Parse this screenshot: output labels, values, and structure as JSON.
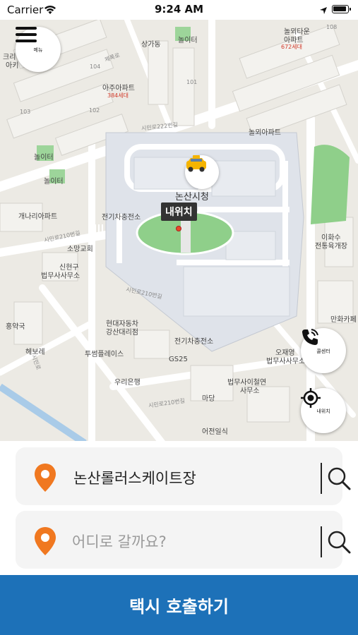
{
  "status_bar": {
    "carrier": "Carrier",
    "time": "9:24 AM"
  },
  "map": {
    "menu_label": "메뉴",
    "call_center_label": "콜센터",
    "my_location_label": "내위치",
    "my_location_tag": "내위치",
    "city_hall": "논산시청",
    "places": {
      "shopping": "상가동",
      "playground_top": "놀이터",
      "nolwe_town": "놀뫼타운",
      "nolwe_town2": "아파트",
      "nolwe_units": "672세대",
      "ajoo": "아주아파트",
      "ajoo_units": "384세대",
      "nolwe_apt": "놀뫼아파트",
      "kurdo": "크리",
      "kurdo2": "아키",
      "playground_left1": "놀이터",
      "playground_left2": "놀이터",
      "gaenari": "개나리아파트",
      "ev_charge1": "전기차충전소",
      "somang": "소망교회",
      "shinhyeon": "신현구",
      "shinhyeon2": "법무사사무소",
      "ihwasu": "이화수",
      "ihwasu2": "전통육개장",
      "hongyak": "홍약국",
      "hyundai": "현대자동차",
      "hyundai2": "강산대리점",
      "manhwa": "만화카페",
      "hebo": "헤보레",
      "tusum": "투썸플레이스",
      "ev_charge2": "전기차충전소",
      "oh_jae": "오재영",
      "oh_jae2": "법무사사무소",
      "gs25": "GS25",
      "woori": "우리은행",
      "bupmu": "법무사이철연",
      "bupmu2": "사무소",
      "madang": "마당",
      "eojeon": "어전일식"
    },
    "roads": {
      "r1": "시민로222번길",
      "r2": "시민로210번길",
      "r3": "시민로210번길",
      "r4": "시민로210번길",
      "r5": "시민로",
      "r6": "제록로"
    },
    "blocks": {
      "b104": "104",
      "b103": "103",
      "b102": "102",
      "b101": "101",
      "b108": "108"
    }
  },
  "search": {
    "origin_value": "논산롤러스케이트장",
    "destination_placeholder": "어디로 갈까요?"
  },
  "call_button_label": "택시 호출하기",
  "colors": {
    "primary": "#1d71b8",
    "pin_orange": "#f07820",
    "map_green": "#8fcf8a"
  }
}
